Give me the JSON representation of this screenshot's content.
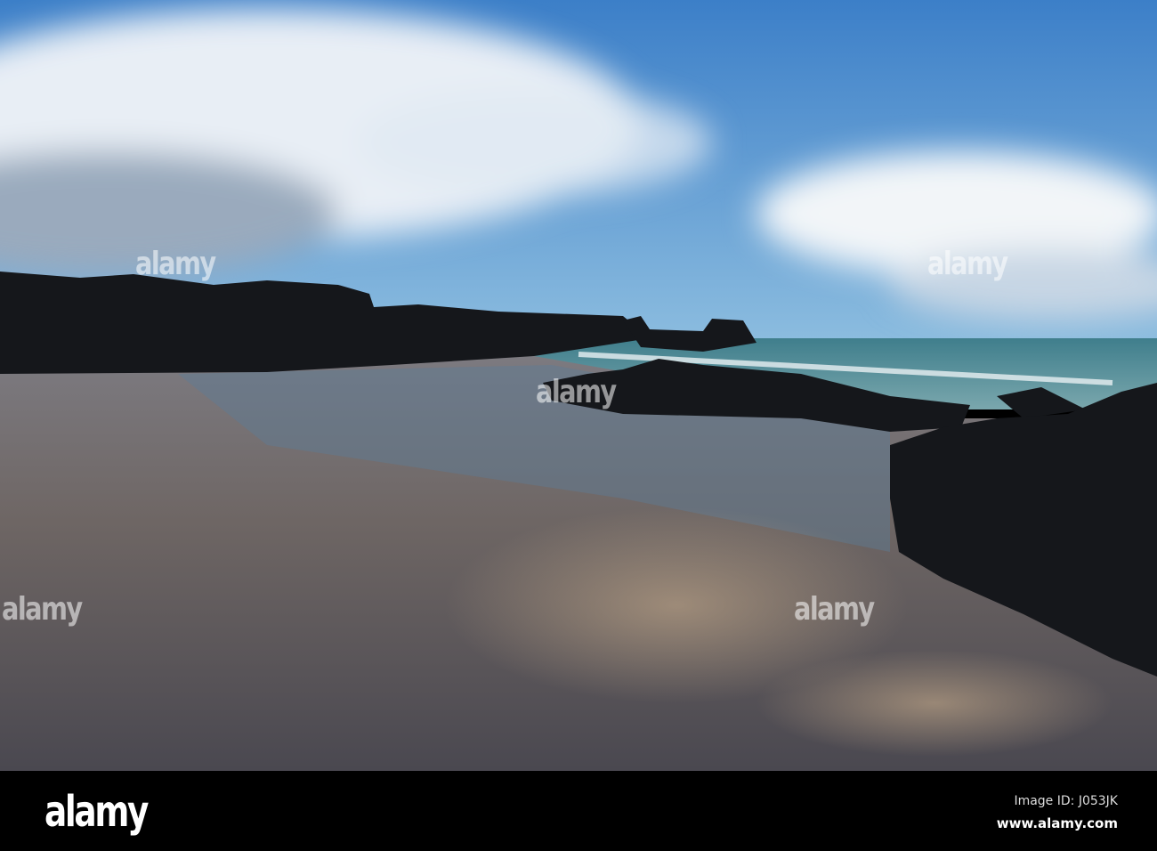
{
  "watermark": {
    "text": "alamy"
  },
  "footer": {
    "logo": "alamy",
    "image_id": "Image ID: J053JK",
    "website": "www.alamy.com"
  },
  "colors": {
    "sky": "#3f86cf",
    "sea": "#4f8d98",
    "sand": "#6b6562",
    "rock": "#121418"
  }
}
